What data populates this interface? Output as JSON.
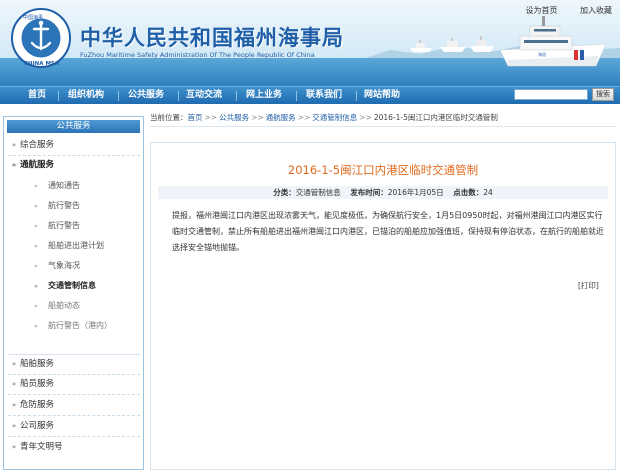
{
  "header": {
    "title_cn": "中华人民共和国福州海事局",
    "title_en": "FuZhou Maritime Safety Administration Of The People Republic Of China",
    "logo_text": "CHINA MSA",
    "logo_arc_text": "中国海事",
    "top_links": [
      "设为首页",
      "加入收藏"
    ]
  },
  "nav": {
    "items": [
      "首页",
      "组织机构",
      "公共服务",
      "互动交流",
      "网上业务",
      "联系我们",
      "网站帮助"
    ],
    "search_button": "搜索"
  },
  "sidebar": {
    "header": "公共服务",
    "items_top": [
      "综合服务",
      "通航服务"
    ],
    "sub_items": [
      "通知通告",
      "航行警告",
      "航行警告",
      "船舶进出港计划",
      "气象海况",
      "交通管制信息",
      "船舶动态",
      "航行警告（港内）"
    ],
    "active_sub": "交通管制信息",
    "items_bottom": [
      "船舶服务",
      "船员服务",
      "危防服务",
      "公司服务",
      "青年文明号"
    ]
  },
  "breadcrumb": {
    "label": "当前位置：",
    "path": [
      "首页",
      "公共服务",
      "通航服务",
      "交通管制信息"
    ],
    "current": "2016-1-5闽江口内港区临时交通管制"
  },
  "article": {
    "title": "2016-1-5闽江口内港区临时交通管制",
    "category_label": "分类：",
    "category": "交通管制信息",
    "date_label": "发布时间：",
    "date": "2016年1月05日",
    "clicks_label": "点击数：",
    "clicks": "24",
    "body": "提报，福州港闽江口内港区出现浓雾天气，能见度极低，为确保航行安全，1月5日0950时起，对福州港闽江口内港区实行临时交通管制，禁止所有船舶进出福州港闽江口内港区，已锚泊的船舶应加强值班，保持现有停泊状态，在航行的船舶就近选择安全锚地抛锚。",
    "print_label": "[打印]"
  },
  "colors": {
    "brand_blue": "#1f5fa8",
    "nav_blue": "#1e6bb0",
    "headline_orange": "#e06a1e"
  }
}
